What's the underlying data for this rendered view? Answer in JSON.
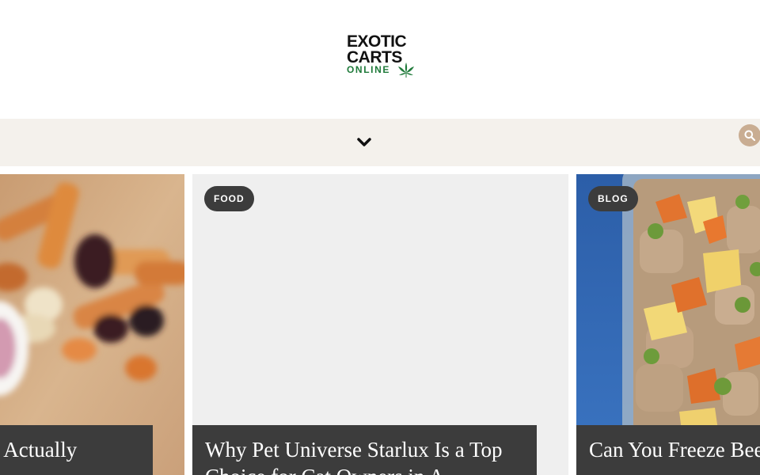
{
  "brand": {
    "logo_line1": "EXOTIC",
    "logo_line2": "CARTS",
    "logo_line3": "ONLINE",
    "accent": "#1f7a3a"
  },
  "nav": {
    "menu_icon": "chevron-down-icon",
    "search_icon": "search-icon",
    "background": "#f4f1ec",
    "search_color": "#c9ad92"
  },
  "cards": [
    {
      "category": "",
      "title": "hat Actually"
    },
    {
      "category": "FOOD",
      "title": "Why Pet Universe Starlux Is a Top Choice for Cat Owners in A"
    },
    {
      "category": "BLOG",
      "title": "Can You Freeze Beef Portions & Tips"
    }
  ]
}
